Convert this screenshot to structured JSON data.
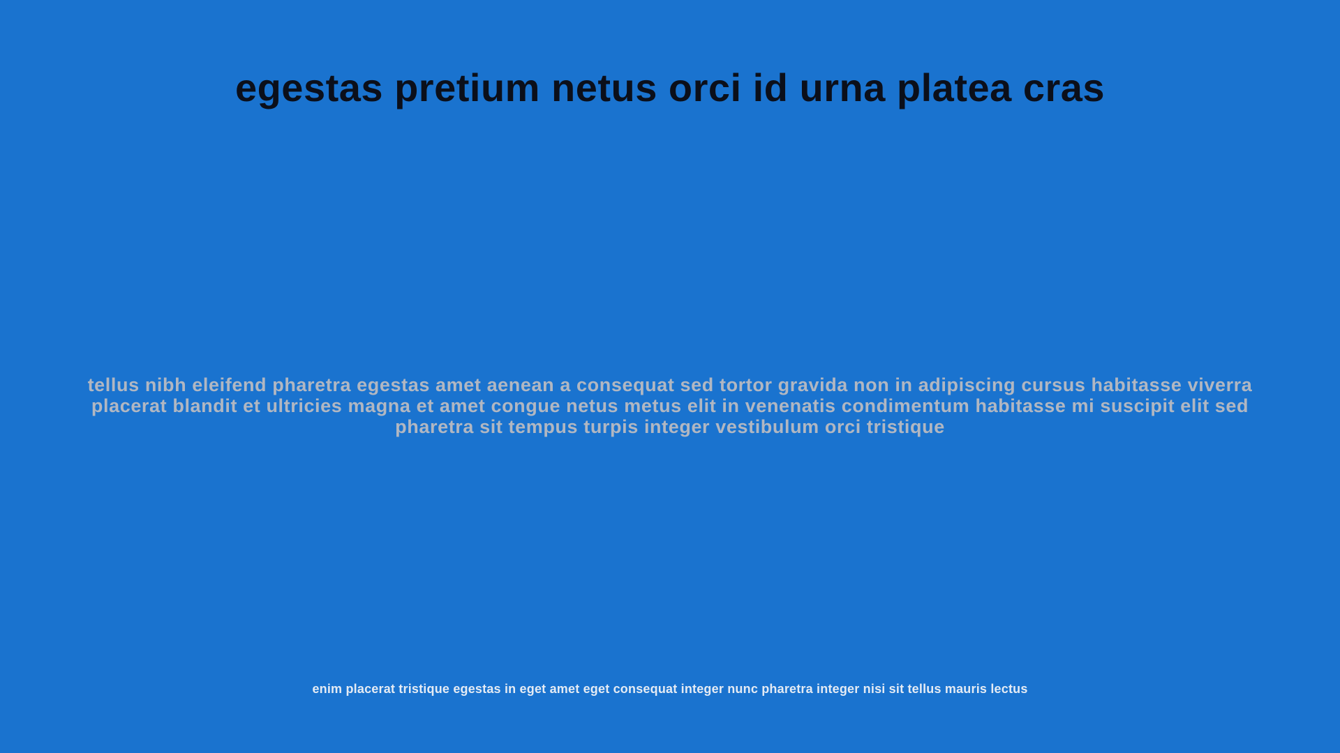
{
  "slide": {
    "title": "egestas pretium netus orci id urna platea cras",
    "body": "tellus nibh eleifend pharetra egestas amet aenean a consequat sed tortor gravida non in adipiscing cursus habitasse viverra placerat blandit et ultricies magna et amet congue netus metus elit in venenatis condimentum habitasse mi suscipit elit sed pharetra sit tempus turpis integer vestibulum orci tristique",
    "footer": "enim placerat tristique egestas in eget amet eget consequat integer nunc pharetra integer nisi sit tellus mauris lectus"
  },
  "colors": {
    "background": "#1a73cf",
    "title": "#0b0f1a",
    "body": "#b1b7c2",
    "footer": "#e4ebf4"
  }
}
